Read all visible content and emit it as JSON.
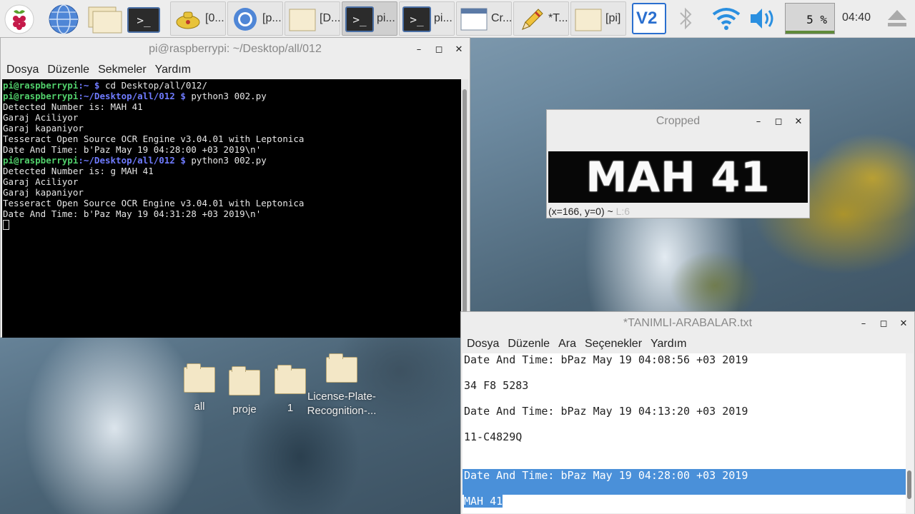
{
  "taskbar": {
    "launchers": [
      {
        "name": "raspberry-menu",
        "icon": "raspberry-icon"
      },
      {
        "name": "web-browser",
        "icon": "globe-icon"
      },
      {
        "name": "file-manager",
        "icon": "folder-icon"
      },
      {
        "name": "terminal",
        "icon": "terminal-icon"
      }
    ],
    "tasks": [
      {
        "label": "[0...",
        "icon": "genie-lamp-icon"
      },
      {
        "label": "[p...",
        "icon": "chromium-icon"
      },
      {
        "label": "[D...",
        "icon": "folder-icon"
      },
      {
        "label": "pi...",
        "icon": "terminal-icon",
        "active": true
      },
      {
        "label": "pi...",
        "icon": "terminal-icon"
      },
      {
        "label": "Cr...",
        "icon": "window-icon"
      },
      {
        "label": "*T...",
        "icon": "pencil-icon"
      },
      {
        "label": "[pi]",
        "icon": "folder-icon"
      }
    ],
    "tray": {
      "vnc": "V2",
      "cpu": "5 %",
      "clock": "04:40"
    }
  },
  "terminal": {
    "title": "pi@raspberrypi: ~/Desktop/all/012",
    "menu": [
      "Dosya",
      "Düzenle",
      "Sekmeler",
      "Yardım"
    ],
    "lines": [
      {
        "user": "pi@raspberrypi",
        "path": ":~ $",
        "cmd": " cd Desktop/all/012/"
      },
      {
        "user": "pi@raspberrypi",
        "path": ":~/Desktop/all/012 $",
        "cmd": " python3 002.py"
      },
      {
        "text": "Detected Number is: MAH 41"
      },
      {
        "text": "Garaj Aciliyor"
      },
      {
        "text": "Garaj kapaniyor"
      },
      {
        "text": "Tesseract Open Source OCR Engine v3.04.01 with Leptonica"
      },
      {
        "text": "Date And Time: b'Paz May 19 04:28:00 +03 2019\\n'"
      },
      {
        "user": "pi@raspberrypi",
        "path": ":~/Desktop/all/012 $",
        "cmd": " python3 002.py"
      },
      {
        "text": "Detected Number is: g MAH 41"
      },
      {
        "text": "Garaj Aciliyor"
      },
      {
        "text": "Garaj kapaniyor"
      },
      {
        "text": "Tesseract Open Source OCR Engine v3.04.01 with Leptonica"
      },
      {
        "text": "Date And Time: b'Paz May 19 04:31:28 +03 2019\\n'"
      }
    ]
  },
  "cropped": {
    "title": "Cropped",
    "plate_text": "MAH 41",
    "status": "(x=166, y=0) ~",
    "status_faded": "L:6"
  },
  "editor": {
    "title": "*TANIMLI-ARABALAR.txt",
    "menu": [
      "Dosya",
      "Düzenle",
      "Ara",
      "Seçenekler",
      "Yardım"
    ],
    "lines": [
      {
        "text": "Date And Time: bPaz May 19 04:08:56 +03 2019",
        "sel": false
      },
      {
        "text": "",
        "sel": false
      },
      {
        "text": "34 F8 5283",
        "sel": false
      },
      {
        "text": "",
        "sel": false
      },
      {
        "text": "Date And Time: bPaz May 19 04:13:20 +03 2019",
        "sel": false
      },
      {
        "text": "",
        "sel": false
      },
      {
        "text": "11-C4829Q",
        "sel": false
      },
      {
        "text": "",
        "sel": false
      },
      {
        "text": "",
        "sel": false
      },
      {
        "text": "Date And Time: bPaz May 19 04:28:00 +03 2019",
        "sel": "full"
      },
      {
        "text": "",
        "sel": "full"
      },
      {
        "text": "MAH 41",
        "sel": "part"
      }
    ]
  },
  "desktop_icons": [
    "all",
    "proje",
    "1",
    "License-Plate-Recognition-..."
  ]
}
